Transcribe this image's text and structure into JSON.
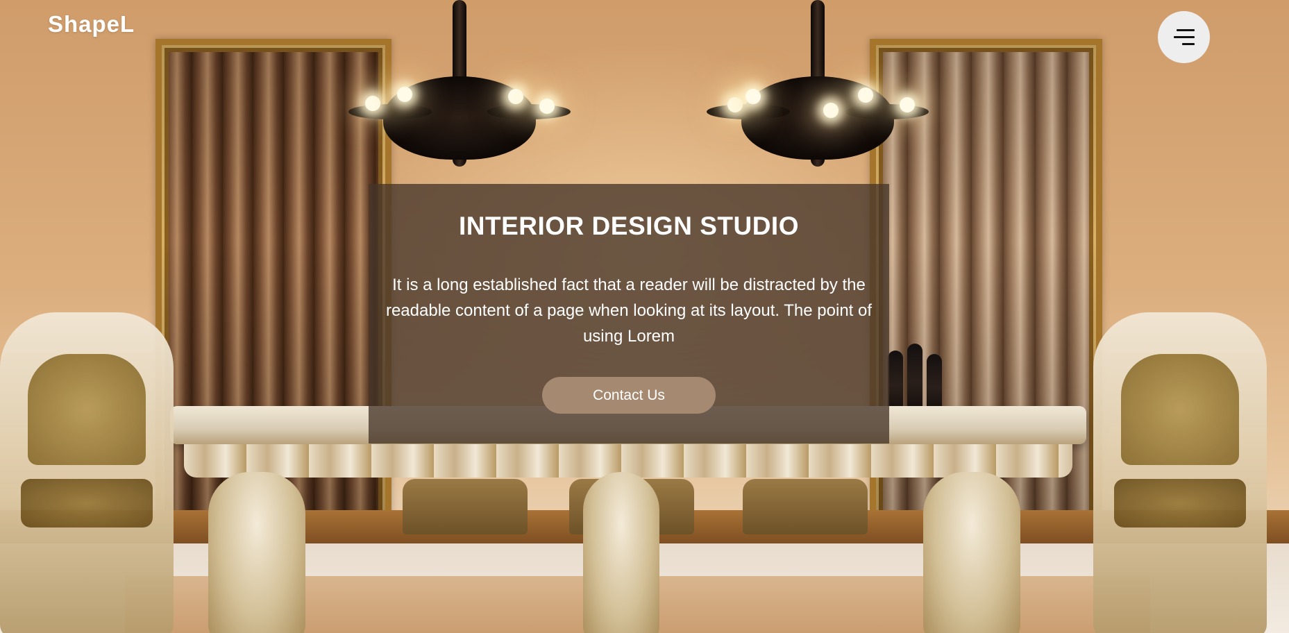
{
  "brand": {
    "logo_text": "ShapeL"
  },
  "nav": {
    "menu_icon": "hamburger-menu-icon"
  },
  "hero": {
    "title": "INTERIOR DESIGN STUDIO",
    "description": "It is a long established fact that a reader will be distracted by the readable content of a page when looking at its layout. The point of using Lorem",
    "cta_label": "Contact Us",
    "background": "dining room with chandeliers, curtains and ornate dining table"
  },
  "colors": {
    "overlay": "#46362a",
    "cta_background": "#a58a71",
    "menu_button_bg": "#eeeeee",
    "text": "#ffffff"
  }
}
